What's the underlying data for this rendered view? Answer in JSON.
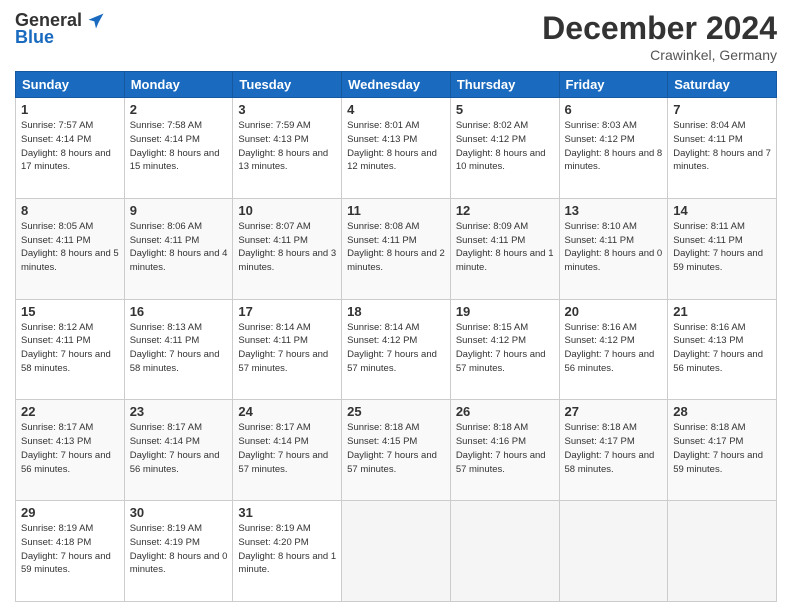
{
  "header": {
    "logo_general": "General",
    "logo_blue": "Blue",
    "month_title": "December 2024",
    "location": "Crawinkel, Germany"
  },
  "days_of_week": [
    "Sunday",
    "Monday",
    "Tuesday",
    "Wednesday",
    "Thursday",
    "Friday",
    "Saturday"
  ],
  "weeks": [
    [
      {
        "day": "1",
        "info": "Sunrise: 7:57 AM\nSunset: 4:14 PM\nDaylight: 8 hours and 17 minutes."
      },
      {
        "day": "2",
        "info": "Sunrise: 7:58 AM\nSunset: 4:14 PM\nDaylight: 8 hours and 15 minutes."
      },
      {
        "day": "3",
        "info": "Sunrise: 7:59 AM\nSunset: 4:13 PM\nDaylight: 8 hours and 13 minutes."
      },
      {
        "day": "4",
        "info": "Sunrise: 8:01 AM\nSunset: 4:13 PM\nDaylight: 8 hours and 12 minutes."
      },
      {
        "day": "5",
        "info": "Sunrise: 8:02 AM\nSunset: 4:12 PM\nDaylight: 8 hours and 10 minutes."
      },
      {
        "day": "6",
        "info": "Sunrise: 8:03 AM\nSunset: 4:12 PM\nDaylight: 8 hours and 8 minutes."
      },
      {
        "day": "7",
        "info": "Sunrise: 8:04 AM\nSunset: 4:11 PM\nDaylight: 8 hours and 7 minutes."
      }
    ],
    [
      {
        "day": "8",
        "info": "Sunrise: 8:05 AM\nSunset: 4:11 PM\nDaylight: 8 hours and 5 minutes."
      },
      {
        "day": "9",
        "info": "Sunrise: 8:06 AM\nSunset: 4:11 PM\nDaylight: 8 hours and 4 minutes."
      },
      {
        "day": "10",
        "info": "Sunrise: 8:07 AM\nSunset: 4:11 PM\nDaylight: 8 hours and 3 minutes."
      },
      {
        "day": "11",
        "info": "Sunrise: 8:08 AM\nSunset: 4:11 PM\nDaylight: 8 hours and 2 minutes."
      },
      {
        "day": "12",
        "info": "Sunrise: 8:09 AM\nSunset: 4:11 PM\nDaylight: 8 hours and 1 minute."
      },
      {
        "day": "13",
        "info": "Sunrise: 8:10 AM\nSunset: 4:11 PM\nDaylight: 8 hours and 0 minutes."
      },
      {
        "day": "14",
        "info": "Sunrise: 8:11 AM\nSunset: 4:11 PM\nDaylight: 7 hours and 59 minutes."
      }
    ],
    [
      {
        "day": "15",
        "info": "Sunrise: 8:12 AM\nSunset: 4:11 PM\nDaylight: 7 hours and 58 minutes."
      },
      {
        "day": "16",
        "info": "Sunrise: 8:13 AM\nSunset: 4:11 PM\nDaylight: 7 hours and 58 minutes."
      },
      {
        "day": "17",
        "info": "Sunrise: 8:14 AM\nSunset: 4:11 PM\nDaylight: 7 hours and 57 minutes."
      },
      {
        "day": "18",
        "info": "Sunrise: 8:14 AM\nSunset: 4:12 PM\nDaylight: 7 hours and 57 minutes."
      },
      {
        "day": "19",
        "info": "Sunrise: 8:15 AM\nSunset: 4:12 PM\nDaylight: 7 hours and 57 minutes."
      },
      {
        "day": "20",
        "info": "Sunrise: 8:16 AM\nSunset: 4:12 PM\nDaylight: 7 hours and 56 minutes."
      },
      {
        "day": "21",
        "info": "Sunrise: 8:16 AM\nSunset: 4:13 PM\nDaylight: 7 hours and 56 minutes."
      }
    ],
    [
      {
        "day": "22",
        "info": "Sunrise: 8:17 AM\nSunset: 4:13 PM\nDaylight: 7 hours and 56 minutes."
      },
      {
        "day": "23",
        "info": "Sunrise: 8:17 AM\nSunset: 4:14 PM\nDaylight: 7 hours and 56 minutes."
      },
      {
        "day": "24",
        "info": "Sunrise: 8:17 AM\nSunset: 4:14 PM\nDaylight: 7 hours and 57 minutes."
      },
      {
        "day": "25",
        "info": "Sunrise: 8:18 AM\nSunset: 4:15 PM\nDaylight: 7 hours and 57 minutes."
      },
      {
        "day": "26",
        "info": "Sunrise: 8:18 AM\nSunset: 4:16 PM\nDaylight: 7 hours and 57 minutes."
      },
      {
        "day": "27",
        "info": "Sunrise: 8:18 AM\nSunset: 4:17 PM\nDaylight: 7 hours and 58 minutes."
      },
      {
        "day": "28",
        "info": "Sunrise: 8:18 AM\nSunset: 4:17 PM\nDaylight: 7 hours and 59 minutes."
      }
    ],
    [
      {
        "day": "29",
        "info": "Sunrise: 8:19 AM\nSunset: 4:18 PM\nDaylight: 7 hours and 59 minutes."
      },
      {
        "day": "30",
        "info": "Sunrise: 8:19 AM\nSunset: 4:19 PM\nDaylight: 8 hours and 0 minutes."
      },
      {
        "day": "31",
        "info": "Sunrise: 8:19 AM\nSunset: 4:20 PM\nDaylight: 8 hours and 1 minute."
      },
      null,
      null,
      null,
      null
    ]
  ]
}
